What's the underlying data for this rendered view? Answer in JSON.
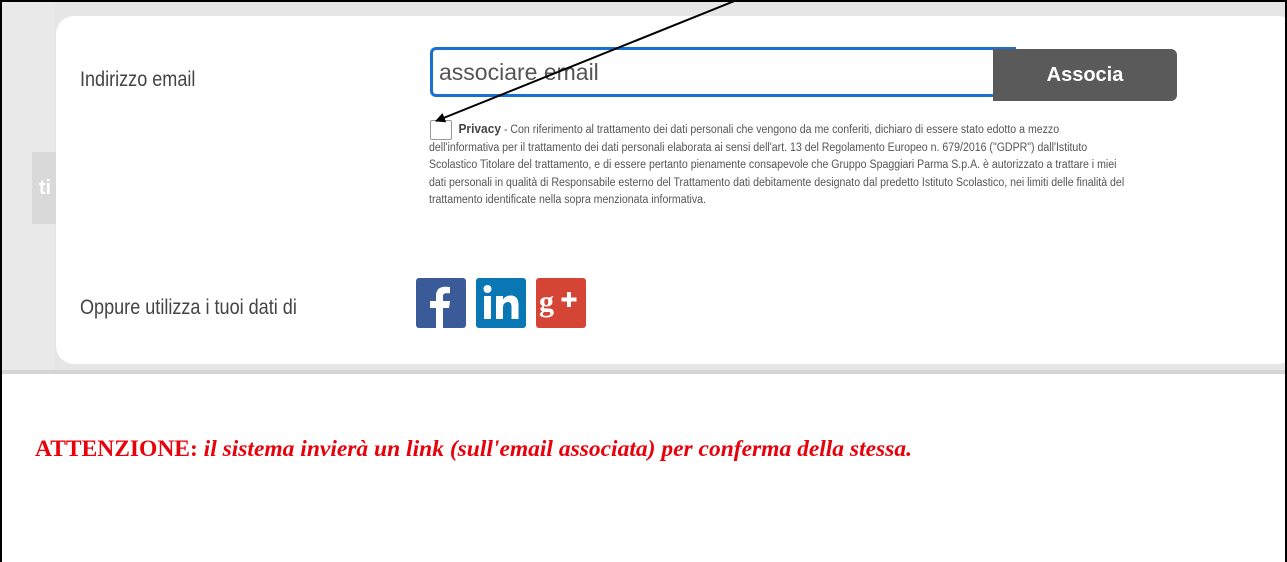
{
  "form": {
    "email_label": "Indirizzo email",
    "email_value": "associare email",
    "associate_button": "Associa",
    "privacy_title": "Privacy",
    "privacy_text": " - Con riferimento al trattamento dei dati personali che vengono da me conferiti, dichiaro di essere stato edotto a mezzo dell'informativa per il trattamento dei dati personali elaborata ai sensi dell'art. 13 del Regolamento Europeo n. 679/2016 (\"GDPR\") dall'Istituto Scolastico Titolare del trattamento, e di essere pertanto pienamente consapevole che Gruppo Spaggiari Parma S.p.A. è autorizzato a trattare i miei dati personali in qualità di Responsabile esterno del Trattamento dati debitamente designato dal predetto Istituto Scolastico, nei limiti delle finalità del trattamento identificate nella sopra menzionata informativa.",
    "privacy_checked": false,
    "social_label": "Oppure utilizza i tuoi dati di"
  },
  "social": [
    {
      "name": "facebook-icon",
      "color": "#3b5b98"
    },
    {
      "name": "linkedin-icon",
      "color": "#0a77b5"
    },
    {
      "name": "google-plus-icon",
      "color": "#d54535"
    }
  ],
  "side_tab_text": "ti",
  "note": {
    "prefix": "ATTENZIONE:",
    "text": " il sistema invierà un link (sull'email associata) per conferma della stessa."
  },
  "colors": {
    "accent": "#1a6fd3",
    "button": "#5a5a5a",
    "warning": "#e8000b"
  }
}
